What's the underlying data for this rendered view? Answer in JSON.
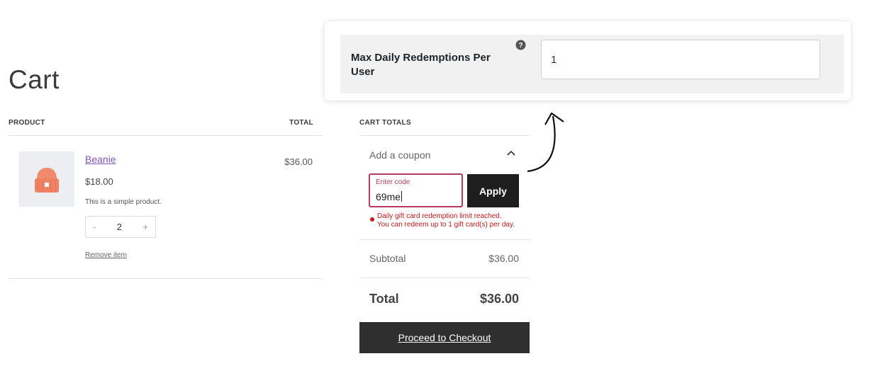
{
  "page": {
    "title": "Cart"
  },
  "cart_table": {
    "col_product": "PRODUCT",
    "col_total": "TOTAL",
    "item": {
      "name": "Beanie",
      "price": "$18.00",
      "description": "This is a simple product.",
      "quantity": "2",
      "qty_minus": "-",
      "qty_plus": "+",
      "remove_label": "Remove item",
      "line_total": "$36.00",
      "thumbnail_icon": "beanie-icon",
      "thumbnail_color": "#f08a6b"
    }
  },
  "cart_totals": {
    "heading": "CART TOTALS",
    "coupon_toggle_label": "Add a coupon",
    "coupon_field_label": "Enter code",
    "coupon_value": "69me",
    "apply_label": "Apply",
    "error_line1": "Daily gift card redemption limit reached.",
    "error_line2": "You can redeem up to 1 gift card(s) per day.",
    "subtotal_label": "Subtotal",
    "subtotal_value": "$36.00",
    "total_label": "Total",
    "total_value": "$36.00",
    "checkout_label": "Proceed to Checkout",
    "error_color": "#cc1818"
  },
  "settings_callout": {
    "label": "Max Daily Redemptions Per User",
    "help_icon": "question-icon",
    "value": "1"
  }
}
